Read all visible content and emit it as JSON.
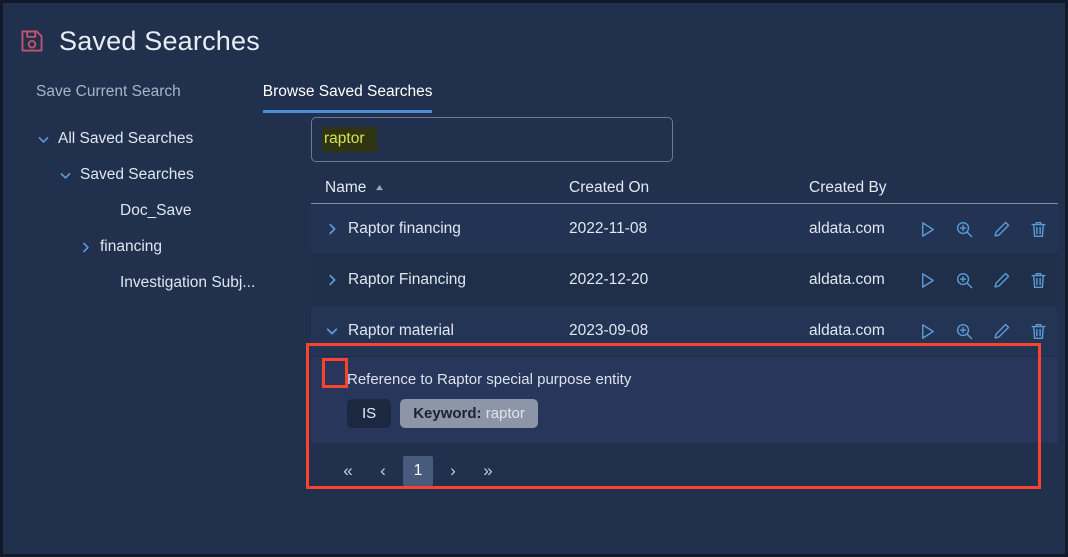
{
  "header": {
    "title": "Saved Searches",
    "icon": "save-floppy-icon"
  },
  "tabs": [
    {
      "label": "Save Current Search",
      "active": false
    },
    {
      "label": "Browse Saved Searches",
      "active": true
    }
  ],
  "tree": [
    {
      "label": "All Saved Searches",
      "level": 1,
      "chevron": "chevron-down-icon"
    },
    {
      "label": "Saved Searches",
      "level": 2,
      "chevron": "chevron-down-icon"
    },
    {
      "label": "Doc_Save",
      "level": 3,
      "chevron": "none"
    },
    {
      "label": "financing",
      "level": 3,
      "chevron": "chevron-right-icon"
    },
    {
      "label": "Investigation Subj...",
      "level": 3,
      "chevron": "none"
    }
  ],
  "search": {
    "value": "raptor",
    "placeholder": "",
    "highlight_bg": "#2f3413",
    "highlight_fg": "#d6e44f"
  },
  "table": {
    "columns": [
      {
        "label": "Name",
        "sort": "asc"
      },
      {
        "label": "Created On",
        "sort": "none"
      },
      {
        "label": "Created By",
        "sort": "none"
      }
    ],
    "rows": [
      {
        "name": "Raptor financing",
        "created_on": "2022-11-08",
        "created_by": "aldata.com",
        "expanded": false,
        "chevron": "chevron-right-icon"
      },
      {
        "name": "Raptor Financing",
        "created_on": "2022-12-20",
        "created_by": "aldata.com",
        "expanded": false,
        "chevron": "chevron-right-icon"
      },
      {
        "name": "Raptor material",
        "created_on": "2023-09-08",
        "created_by": "aldata.com",
        "expanded": true,
        "chevron": "chevron-down-icon"
      }
    ],
    "row_actions": [
      "run-search-icon",
      "zoom-search-icon",
      "edit-pencil-icon",
      "delete-trash-icon"
    ],
    "detail": {
      "description": "Reference to Raptor special purpose entity",
      "operator_chip": "IS",
      "criteria_label": "Keyword:",
      "criteria_value": "raptor"
    }
  },
  "pagination": {
    "first": "«",
    "prev": "‹",
    "current_page": "1",
    "next": "›",
    "last": "»"
  },
  "annotations": {
    "color": "#f8432f",
    "row_box": "expanded-row-highlight",
    "chevron_box": "expand-toggle-highlight"
  }
}
